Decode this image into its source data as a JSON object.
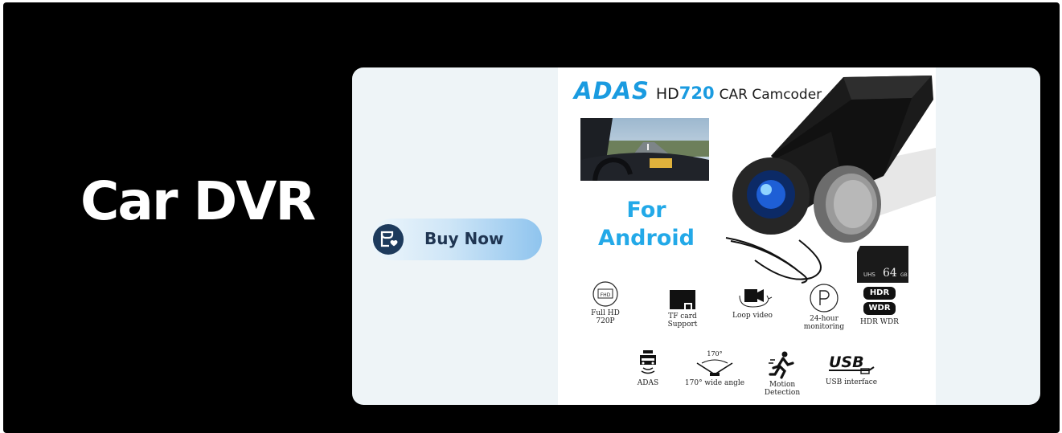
{
  "headline": "Car DVR",
  "buy_button": {
    "label": "Buy Now",
    "icon": "shopping-bag-heart-icon"
  },
  "product": {
    "brand": "ADAS",
    "model_prefix": "HD",
    "model_number": "720",
    "model_suffix": "CAR Camcoder",
    "platform_line1": "For",
    "platform_line2": "Android",
    "sd_card_label": "64",
    "sd_card_unit": "GB",
    "sd_card_small": "UHS",
    "badges": [
      "HDR",
      "WDR"
    ],
    "features_row1": [
      {
        "label1": "Full HD",
        "label2": "720P",
        "icon": "fhd-icon"
      },
      {
        "label1": "TF card",
        "label2": "Support",
        "icon": "sd-card-icon"
      },
      {
        "label1": "Loop video",
        "label2": "",
        "icon": "loop-camera-icon"
      },
      {
        "label1": "24-hour",
        "label2": "monitoring",
        "icon": "parking-icon"
      },
      {
        "label1": "HDR WDR",
        "label2": "",
        "icon": "hdr-wdr-icon"
      }
    ],
    "features_row2": [
      {
        "label1": "ADAS",
        "label2": "",
        "icon": "car-alert-icon"
      },
      {
        "label1": "170° wide angle",
        "label2": "",
        "icon": "wide-angle-icon",
        "angle": "170°"
      },
      {
        "label1": "Motion",
        "label2": "Detection",
        "icon": "running-man-icon"
      },
      {
        "label1": "USB interface",
        "label2": "",
        "icon": "usb-icon",
        "usb_text": "USB"
      }
    ]
  },
  "colors": {
    "background": "#000000",
    "card": "#eef4f7",
    "accent": "#1a9be0",
    "button_text": "#1f3552"
  }
}
